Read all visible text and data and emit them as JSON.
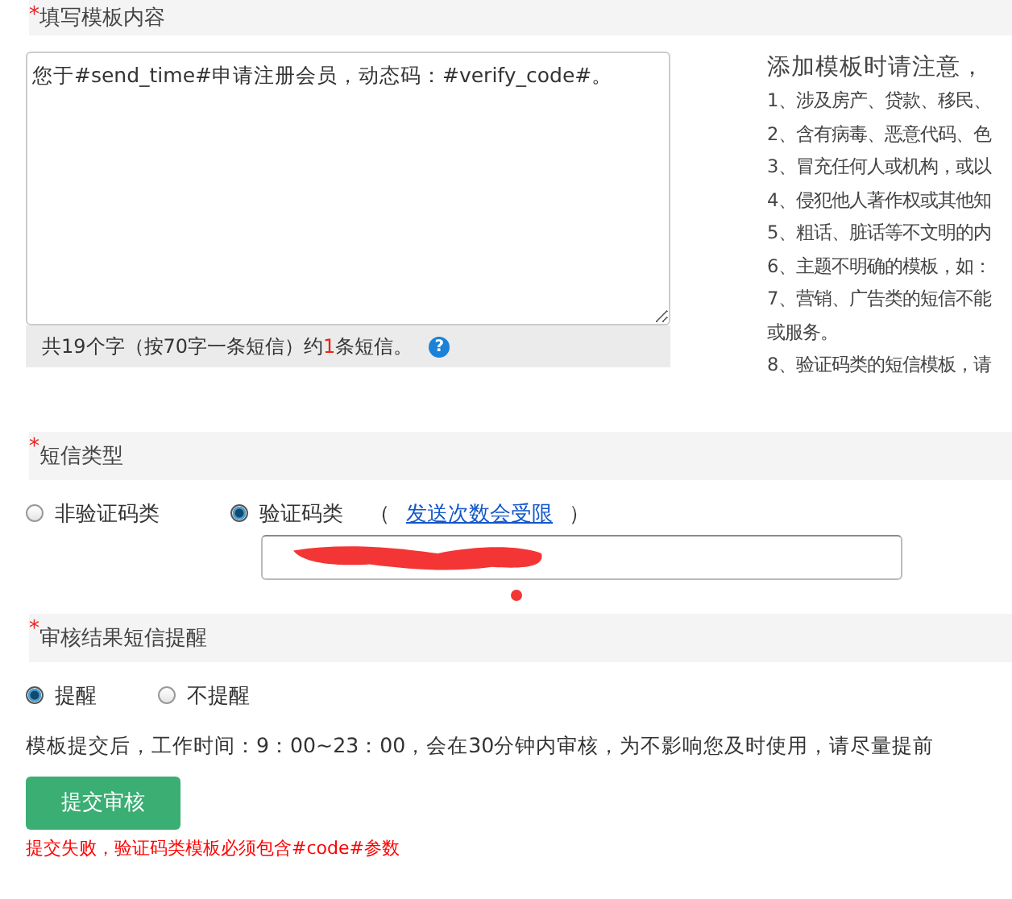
{
  "content_section": {
    "title": "填写模板内容",
    "required_mark": "*",
    "template_text": "您于#send_time#申请注册会员，动态码：#verify_code#。",
    "count_before": "共19个字（按70字一条短信）约",
    "count_number": "1",
    "count_after": "条短信。",
    "help_icon": "?"
  },
  "notes": {
    "title": "添加模板时请注意，",
    "items": [
      "1、涉及房产、贷款、移民、",
      "2、含有病毒、恶意代码、色",
      "3、冒充任何人或机构，或以",
      "4、侵犯他人著作权或其他知",
      "5、粗话、脏话等不文明的内",
      "6、主题不明确的模板，如：",
      "7、营销、广告类的短信不能",
      "或服务。",
      "8、验证码类的短信模板，请"
    ]
  },
  "type_section": {
    "title": "短信类型",
    "required_mark": "*",
    "options": [
      {
        "label": "非验证码类",
        "selected": false
      },
      {
        "label": "验证码类",
        "selected": true
      }
    ],
    "paren_open": "（",
    "link": "发送次数会受限",
    "paren_close": "）"
  },
  "remind_section": {
    "title": "审核结果短信提醒",
    "required_mark": "*",
    "options": [
      {
        "label": "提醒",
        "selected": true
      },
      {
        "label": "不提醒",
        "selected": false
      }
    ]
  },
  "notice": "模板提交后，工作时间：9：00~23：00，会在30分钟内审核，为不影响您及时使用，请尽量提前",
  "submit_button": "提交审核",
  "error": "提交失败，验证码类模板必须包含#code#参数"
}
